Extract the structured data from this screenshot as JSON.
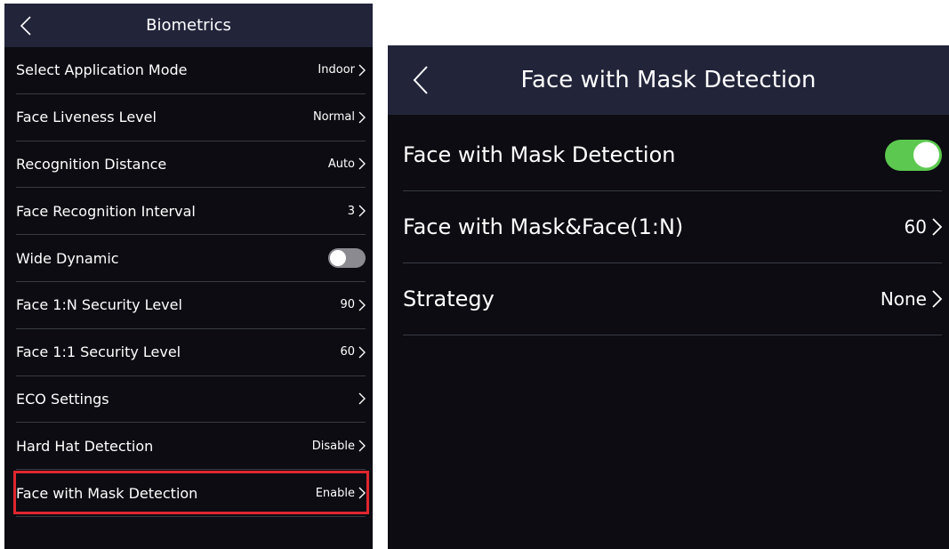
{
  "left_panel": {
    "title": "Biometrics",
    "rows": [
      {
        "label": "Select Application Mode",
        "value": "Indoor"
      },
      {
        "label": "Face Liveness Level",
        "value": "Normal"
      },
      {
        "label": "Recognition Distance",
        "value": "Auto"
      },
      {
        "label": "Face Recognition Interval",
        "value": "3"
      },
      {
        "label": "Wide Dynamic",
        "toggle": false
      },
      {
        "label": "Face 1:N Security Level",
        "value": "90"
      },
      {
        "label": "Face 1:1 Security Level",
        "value": "60"
      },
      {
        "label": "ECO Settings",
        "value": ""
      },
      {
        "label": "Hard Hat Detection",
        "value": "Disable"
      },
      {
        "label": "Face with Mask Detection",
        "value": "Enable",
        "highlighted": true
      }
    ]
  },
  "right_panel": {
    "title": "Face with Mask Detection",
    "rows": [
      {
        "label": "Face with Mask Detection",
        "toggle": true
      },
      {
        "label": "Face with Mask&Face(1:N)",
        "value": "60"
      },
      {
        "label": "Strategy",
        "value": "None"
      }
    ]
  },
  "colors": {
    "background": "#0c0c12",
    "header": "#22243a",
    "divider": "#3a3a44",
    "toggle_on": "#5cc84f",
    "toggle_off": "#8a8a90",
    "highlight": "#e0262e"
  }
}
